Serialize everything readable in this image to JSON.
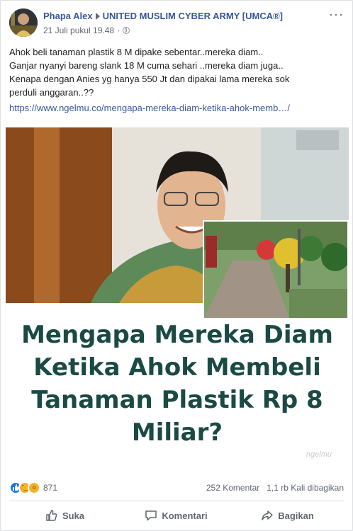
{
  "post": {
    "author": "Phapa Alex",
    "group": "UNITED MUSLIM CYBER ARMY [UMCA®]",
    "timestamp": "21 Juli pukul 19.48",
    "text_lines": [
      "Ahok beli tanaman plastik 8 M dipake sebentar..mereka diam..",
      "Ganjar nyanyi bareng slank 18 M cuma sehari ..mereka diam juga..",
      "Kenapa dengan Anies yg hanya 550 Jt dan dipakai lama mereka sok",
      "perduli anggaran..??"
    ],
    "link": "https://www.ngelmu.co/mengapa-mereka-diam-ketika-ahok-memb…/"
  },
  "image": {
    "headline_lines": [
      "Mengapa Mereka Diam",
      "Ketika Ahok Membeli",
      "Tanaman Plastik Rp 8",
      "Miliar?"
    ],
    "watermark": "ngelmu"
  },
  "stats": {
    "reaction_count": "871",
    "comments": "252 Komentar",
    "shares": "1,1 rb Kali dibagikan"
  },
  "actions": {
    "like": "Suka",
    "comment": "Komentari",
    "share": "Bagikan"
  },
  "icons": {
    "privacy": "globe-icon",
    "more": "more-options-icon",
    "like": "thumbs-up-icon",
    "comment": "comment-bubble-icon",
    "share": "share-arrow-icon"
  },
  "colors": {
    "author_link": "#385898",
    "headline": "#1b4a45",
    "like_reaction": "#1877f2",
    "haha_reaction": "#f7b125"
  }
}
